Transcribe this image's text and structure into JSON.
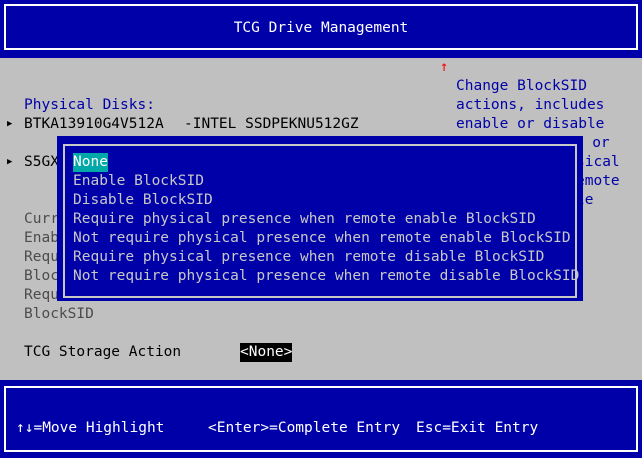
{
  "title": "TCG Drive Management",
  "help": {
    "lines": [
      "Change BlockSID",
      "actions, includes",
      "enable or disable",
      "re or",
      "sical",
      "emote",
      "le"
    ]
  },
  "physical_disks": {
    "heading": "Physical Disks:",
    "disk1_serial": "BTKA13910G4V512A",
    "disk1_model": "-INTEL SSDPEKNU512GZ",
    "disk2_serial": "S5GX"
  },
  "info_lines": [
    "Curr",
    "Enab",
    "Requ",
    "Bloc",
    "Requ",
    "BlockSID"
  ],
  "action": {
    "label": "TCG Storage Action",
    "value": "<None>"
  },
  "popup": {
    "options": [
      "None",
      "Enable BlockSID",
      "Disable BlockSID",
      "Require physical presence when remote enable BlockSID",
      "Not require physical presence when remote enable BlockSID",
      "Require physical presence when remote disable BlockSID",
      "Not require physical presence when remote disable BlockSID"
    ],
    "selected_index": 0
  },
  "footer": {
    "move": "↑↓=Move Highlight",
    "enter": "<Enter>=Complete Entry",
    "esc": "Esc=Exit Entry"
  },
  "icons": {
    "scroll_up": "↑",
    "bullet": "▶"
  },
  "colors": {
    "bios_blue": "#0000a8",
    "bios_gray": "#c0c0c0",
    "highlight_cyan": "#00a8a8",
    "scroll_red": "#ff0000"
  }
}
